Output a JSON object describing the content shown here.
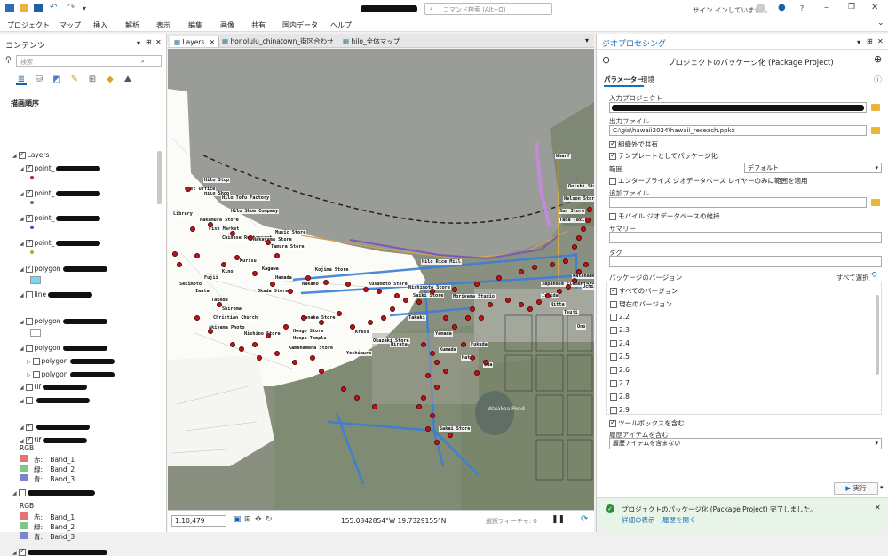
{
  "titlebar": {
    "search_placeholder": "コマンド検索 (Alt+Q)",
    "signin": "サイン インしていません",
    "help": "?"
  },
  "menu": [
    "プロジェクト",
    "マップ",
    "挿入",
    "解析",
    "表示",
    "編集",
    "画像",
    "共有",
    "国内データ",
    "ヘルプ"
  ],
  "contents": {
    "title": "コンテンツ",
    "filter_placeholder": "検索",
    "section": "描画順序",
    "layers": [
      {
        "name": "Layers",
        "checked": true,
        "indent": 0,
        "expanded": true
      },
      {
        "name": "point_",
        "checked": true,
        "indent": 1,
        "swatch": "#a33",
        "dot": true
      },
      {
        "name": "point_",
        "checked": true,
        "indent": 1,
        "swatch": "#4a8a3a",
        "dot": true
      },
      {
        "name": "point_",
        "checked": true,
        "indent": 1,
        "swatch": "#5b4ab0",
        "dot": true
      },
      {
        "name": "point_",
        "checked": true,
        "indent": 1,
        "swatch": "#b8a43a",
        "dot": true
      },
      {
        "name": "polygon",
        "checked": true,
        "indent": 1,
        "swatch": "#7ad6ec",
        "dot": false
      },
      {
        "name": "line",
        "checked": false,
        "indent": 1
      },
      {
        "name": "polygon",
        "checked": false,
        "indent": 1,
        "swatch": "#ffffff",
        "dot": false
      },
      {
        "name": "polygon",
        "checked": false,
        "indent": 1
      },
      {
        "name": "polygon",
        "checked": false,
        "indent": 2
      },
      {
        "name": "polygon",
        "checked": false,
        "indent": 2
      },
      {
        "name": "tif",
        "checked": false,
        "indent": 1
      },
      {
        "name": "",
        "checked": false,
        "indent": 1
      },
      {
        "name": "",
        "checked": true,
        "indent": 1
      },
      {
        "name": "tif",
        "checked": true,
        "indent": 1
      }
    ],
    "rgb_groups": [
      {
        "label": "RGB",
        "bands": [
          {
            "name": "赤:",
            "band": "Band_1",
            "color": "#e57373"
          },
          {
            "name": "緑:",
            "band": "Band_2",
            "color": "#81c784"
          },
          {
            "name": "青:",
            "band": "Band_3",
            "color": "#7986cb"
          }
        ]
      },
      {
        "label": "RGB",
        "bands": [
          {
            "name": "赤:",
            "band": "Band_1",
            "color": "#e57373"
          },
          {
            "name": "緑:",
            "band": "Band_2",
            "color": "#81c784"
          },
          {
            "name": "青:",
            "band": "Band_3",
            "color": "#7986cb"
          }
        ]
      }
    ]
  },
  "map_tabs": [
    {
      "label": "Layers",
      "active": true
    },
    {
      "label": "honolulu_chinatown_街区合わせ",
      "active": false
    },
    {
      "label": "hilo_全体マップ",
      "active": false
    }
  ],
  "map": {
    "scale": "1:10,479",
    "coordinates": "155.0842854°W 19.7329155°N",
    "selected_features": "選択フィーチャ: 0",
    "labels": [
      "Hilo Shop",
      "Post Office",
      "Hilo Tofu Factory",
      "Hilo Stop",
      "Wharf",
      "Onishi Store",
      "Nelson Store",
      "Sun Store",
      "Tada Taxi",
      "Kusumoto Store",
      "Nishimoto Store",
      "Saiki Store",
      "Moriyama Studio",
      "Tanaka Store",
      "Japanese Elementary School",
      "Nishino Store",
      "Honpa Temple",
      "Kress",
      "Okazaki Store",
      "Hirata",
      "Yamada",
      "Kumada",
      "Sakai Store",
      "Hilo Rice Mill",
      "Library",
      "Nakamura Store",
      "Fish Market",
      "Chinese Restaurant",
      "Nakayama Store",
      "Tamura Store",
      "Hilo Shoe Company",
      "Music Store",
      "Kurisu",
      "Kagawa",
      "Kino",
      "Hamada",
      "Nakano",
      "Fujii",
      "Sekimoto",
      "Iwata",
      "Takeda",
      "Shiroma",
      "Okada Store",
      "Kojima Store",
      "Hongo Store",
      "Yoshimura",
      "Takaki",
      "Ishida",
      "Nitta",
      "Tsuji",
      "Watanabe",
      "Uchida",
      "Christian Church",
      "Akiyama Photo",
      "Kamehameha Store",
      "Fukuda",
      "Hata",
      "Oda",
      "Ono"
    ],
    "water_label": "Waiakea Pond"
  },
  "geoprocessing": {
    "title": "ジオプロセシング",
    "tool_title": "プロジェクトのパッケージ化 (Package Project)",
    "tabs": [
      {
        "label": "パラメーター",
        "active": true
      },
      {
        "label": "環境",
        "active": false
      }
    ],
    "input_project_label": "入力プロジェクト",
    "output_file_label": "出力ファイル",
    "output_file_value": "C:\\gis\\hawaii2024\\hawaii_reseach.ppkx",
    "share_outside": "組織外で共有",
    "as_template": "テンプレートとしてパッケージ化",
    "extent_label": "範囲",
    "extent_value": "デフォルト",
    "enterprise_only": "エンタープライズ ジオデータベース レイヤーのみに範囲を適用",
    "additional_files_label": "追加ファイル",
    "mobile_gdb": "モバイル ジオデータベースの維持",
    "summary_label": "サマリー",
    "tags_label": "タグ",
    "package_version_label": "パッケージのバージョン",
    "select_all": "すべて選択",
    "versions": [
      {
        "label": "すべてのバージョン",
        "checked": true
      },
      {
        "label": "現在のバージョン",
        "checked": false
      },
      {
        "label": "2.2",
        "checked": false
      },
      {
        "label": "2.3",
        "checked": false
      },
      {
        "label": "2.4",
        "checked": false
      },
      {
        "label": "2.5",
        "checked": false
      },
      {
        "label": "2.6",
        "checked": false
      },
      {
        "label": "2.7",
        "checked": false
      },
      {
        "label": "2.8",
        "checked": false
      },
      {
        "label": "2.9",
        "checked": false
      }
    ],
    "include_toolboxes": "ツールボックスを含む",
    "history_label": "履歴アイテムを含む",
    "history_value": "履歴アイテムを含まない",
    "run_button": "実行",
    "toast_message": "プロジェクトのパッケージ化 (Package Project) 完了しました。",
    "toast_details": "詳細の表示",
    "toast_history": "履歴を開く"
  },
  "colors": {
    "accent": "#1a6fb5",
    "red_point": "#c0141c",
    "title_blue": "#1a6fb5"
  }
}
